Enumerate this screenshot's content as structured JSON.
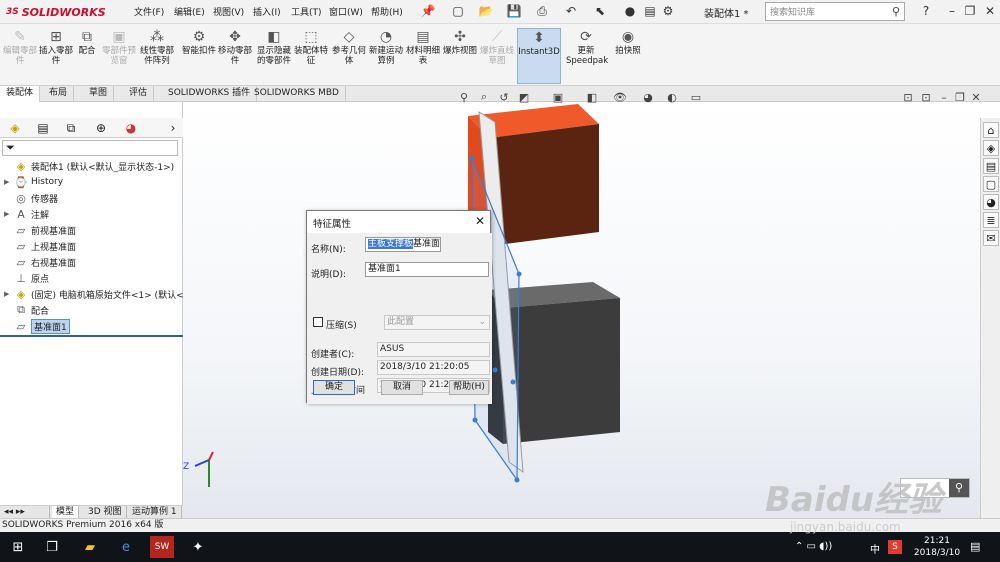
{
  "app": {
    "name": "SOLIDWORKS",
    "doc_title": "装配体1 *"
  },
  "menus": [
    "文件(F)",
    "编辑(E)",
    "视图(V)",
    "插入(I)",
    "工具(T)",
    "窗口(W)",
    "帮助(H)"
  ],
  "search": {
    "placeholder": "搜索知识库"
  },
  "commands": [
    {
      "label": "编辑零部件",
      "icon": "edit-component-icon",
      "glyph": "✎",
      "dim": true
    },
    {
      "label": "插入零部件",
      "icon": "insert-component-icon",
      "glyph": "⊞",
      "dim": false
    },
    {
      "label": "配合",
      "icon": "mate-icon",
      "glyph": "⧉",
      "dim": false
    },
    {
      "label": "零部件预览窗",
      "icon": "component-preview-icon",
      "glyph": "▣",
      "dim": true
    },
    {
      "label": "线性零部件阵列",
      "icon": "linear-pattern-icon",
      "glyph": "⁂",
      "dim": false
    },
    {
      "label": "智能扣件",
      "icon": "smart-fastener-icon",
      "glyph": "⚙",
      "dim": false
    },
    {
      "label": "移动零部件",
      "icon": "move-component-icon",
      "glyph": "✥",
      "dim": false
    },
    {
      "label": "显示隐藏的零部件",
      "icon": "show-hidden-icon",
      "glyph": "◧",
      "dim": false
    },
    {
      "label": "装配体特征",
      "icon": "assembly-feature-icon",
      "glyph": "⬚",
      "dim": false
    },
    {
      "label": "参考几何体",
      "icon": "reference-geometry-icon",
      "glyph": "◇",
      "dim": false
    },
    {
      "label": "新建运动算例",
      "icon": "motion-study-icon",
      "glyph": "◔",
      "dim": false
    },
    {
      "label": "材料明细表",
      "icon": "bom-icon",
      "glyph": "▤",
      "dim": false
    },
    {
      "label": "爆炸视图",
      "icon": "exploded-view-icon",
      "glyph": "✣",
      "dim": false
    },
    {
      "label": "爆炸直线草图",
      "icon": "explode-line-icon",
      "glyph": "⟋",
      "dim": true
    },
    {
      "label": "Instant3D",
      "icon": "instant3d-icon",
      "glyph": "⬍",
      "dim": false,
      "active": true
    },
    {
      "label": "更新Speedpak",
      "icon": "speedpak-icon",
      "glyph": "⟳",
      "dim": false
    },
    {
      "label": "拍快照",
      "icon": "snapshot-icon",
      "glyph": "◉",
      "dim": false
    }
  ],
  "tabs": [
    "装配体",
    "布局",
    "草图",
    "评估",
    "SOLIDWORKS 插件",
    "SOLIDWORKS MBD"
  ],
  "tree": [
    {
      "label": "装配体1  (默认<默认_显示状态-1>)",
      "icon": "assembly-icon",
      "glyph": "◈",
      "arrow": ""
    },
    {
      "label": "History",
      "icon": "history-icon",
      "glyph": "⌚",
      "arrow": "▶"
    },
    {
      "label": "传感器",
      "icon": "sensor-icon",
      "glyph": "◎",
      "arrow": ""
    },
    {
      "label": "注解",
      "icon": "annotation-icon",
      "glyph": "A",
      "arrow": "▶"
    },
    {
      "label": "前视基准面",
      "icon": "plane-icon",
      "glyph": "▱",
      "arrow": ""
    },
    {
      "label": "上视基准面",
      "icon": "plane-icon",
      "glyph": "▱",
      "arrow": ""
    },
    {
      "label": "右视基准面",
      "icon": "plane-icon",
      "glyph": "▱",
      "arrow": ""
    },
    {
      "label": "原点",
      "icon": "origin-icon",
      "glyph": "⊥",
      "arrow": ""
    },
    {
      "label": "(固定) 电脑机箱原始文件<1> (默认<",
      "icon": "part-icon",
      "glyph": "◈",
      "arrow": "▶"
    },
    {
      "label": "配合",
      "icon": "mates-icon",
      "glyph": "⧉",
      "arrow": ""
    },
    {
      "label": "基准面1",
      "icon": "plane-icon",
      "glyph": "▱",
      "arrow": "",
      "selected": true
    }
  ],
  "bottom_tabs": [
    "模型",
    "3D 视图",
    "运动算例 1"
  ],
  "status": "SOLIDWORKS Premium 2016 x64 版",
  "dialog": {
    "title": "特征属性",
    "name_label": "名称(N):",
    "name_value_sel": "主板支撑板",
    "name_value_rest": "基准面",
    "desc_label": "说明(D):",
    "desc_value": "基准面1",
    "suppress_label": "压缩(S)",
    "config_value": "此配置",
    "creator_label": "创建者(C):",
    "creator_value": "ASUS",
    "created_label": "创建日期(D):",
    "created_value": "2018/3/10 21:20:05",
    "modified_label": "上次修改时间",
    "modified_value": "2018/3/10 21:20:05",
    "ok": "确定",
    "cancel": "取消",
    "help": "帮助(H)"
  },
  "taskbar": {
    "time": "21:21",
    "date": "2018/3/10",
    "ime": "中"
  },
  "watermark": {
    "brand": "Baidu经验",
    "url": "jingyan.baidu.com"
  },
  "colors": {
    "orange": "#e14a1e",
    "dark": "#3c3c3c",
    "accent": "#3a77d6"
  }
}
